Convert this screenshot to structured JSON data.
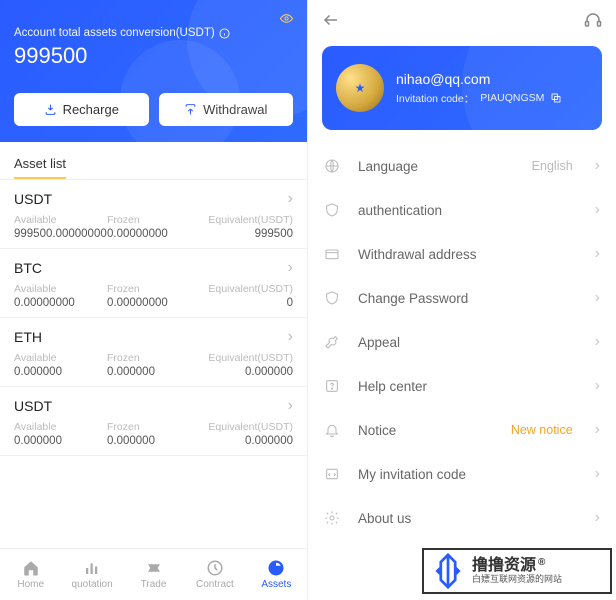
{
  "left": {
    "hero": {
      "title": "Account total assets conversion(USDT)",
      "amount": "999500",
      "recharge": "Recharge",
      "withdrawal": "Withdrawal"
    },
    "asset_list_title": "Asset list",
    "columns": {
      "available": "Available",
      "frozen": "Frozen",
      "equiv": "Equivalent(USDT)"
    },
    "assets": [
      {
        "sym": "USDT",
        "available": "999500.00000000",
        "frozen": "0.00000000",
        "equiv": "999500"
      },
      {
        "sym": "BTC",
        "available": "0.00000000",
        "frozen": "0.00000000",
        "equiv": "0"
      },
      {
        "sym": "ETH",
        "available": "0.000000",
        "frozen": "0.000000",
        "equiv": "0.000000"
      },
      {
        "sym": "USDT",
        "available": "0.000000",
        "frozen": "0.000000",
        "equiv": "0.000000"
      }
    ],
    "tabs": [
      {
        "label": "Home"
      },
      {
        "label": "quotation"
      },
      {
        "label": "Trade"
      },
      {
        "label": "Contract"
      },
      {
        "label": "Assets"
      }
    ]
  },
  "right": {
    "profile": {
      "email": "nihao@qq.com",
      "invite_label": "Invitation code：",
      "invite_code": "PIAUQNGSM"
    },
    "menu": [
      {
        "label": "Language",
        "meta": "English",
        "icon": "globe"
      },
      {
        "label": "authentication",
        "icon": "shield"
      },
      {
        "label": "Withdrawal address",
        "icon": "wallet"
      },
      {
        "label": "Change Password",
        "icon": "shield"
      },
      {
        "label": "Appeal",
        "icon": "wrench"
      },
      {
        "label": "Help center",
        "icon": "help"
      },
      {
        "label": "Notice",
        "meta": "New notice",
        "meta_accent": true,
        "icon": "bell"
      },
      {
        "label": "My invitation code",
        "icon": "code"
      },
      {
        "label": "About us",
        "icon": "gear"
      }
    ]
  },
  "watermark": {
    "main": "撸撸资源",
    "sub": "白嫖互联网资源的网站"
  }
}
